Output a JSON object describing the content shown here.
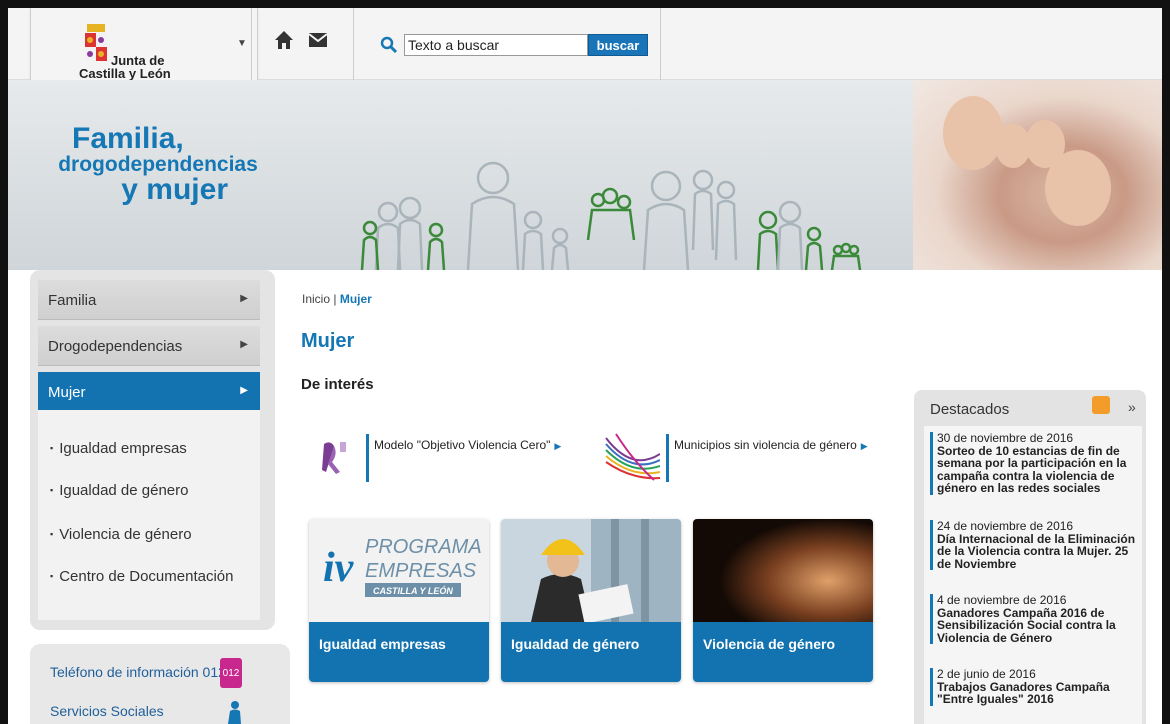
{
  "header": {
    "logo_line1": "Junta de",
    "logo_line2": "Castilla y León",
    "search_placeholder": "Texto a buscar",
    "search_value": "Texto a buscar",
    "search_button": "buscar"
  },
  "banner": {
    "title_line1": "Familia,",
    "title_line2": "drogodependencias",
    "title_line3": "y mujer"
  },
  "nav": {
    "items": [
      {
        "label": "Familia",
        "active": false
      },
      {
        "label": "Drogodependencias",
        "active": false
      },
      {
        "label": "Mujer",
        "active": true
      }
    ],
    "subitems": [
      {
        "label": "Igualdad empresas"
      },
      {
        "label": "Igualdad de género"
      },
      {
        "label": "Violencia de género"
      },
      {
        "label": "Centro de Documentación"
      }
    ],
    "links": [
      {
        "label": "Teléfono de información 012"
      },
      {
        "label": "Servicios Sociales"
      }
    ],
    "phone_icon_text": "012"
  },
  "breadcrumb": {
    "home": "Inicio",
    "current": "Mujer"
  },
  "page_title": "Mujer",
  "section_title": "De interés",
  "interest_links": [
    {
      "label": "Modelo \"Objetivo Violencia Cero\""
    },
    {
      "label": "Municipios sin violencia de género"
    }
  ],
  "cards": [
    {
      "label": "Igualdad empresas",
      "image_text1": "PROGRAMA",
      "image_text2": "EMPRESAS",
      "image_text3": "CASTILLA Y LEÓN"
    },
    {
      "label": "Igualdad de género"
    },
    {
      "label": "Violencia de género"
    }
  ],
  "destacados": {
    "title": "Destacados",
    "more": "»",
    "items": [
      {
        "date": "30 de noviembre de 2016",
        "headline": "Sorteo de 10 estancias de fin de semana por la participación en la campaña contra la violencia de género en las redes sociales"
      },
      {
        "date": "24 de noviembre de 2016",
        "headline": "Día Internacional de la Eliminación de la Violencia contra la Mujer. 25 de Noviembre"
      },
      {
        "date": "4 de noviembre de 2016",
        "headline": "Ganadores Campaña 2016 de Sensibilización Social contra la Violencia de Género"
      },
      {
        "date": "2 de junio de 2016",
        "headline": "Trabajos Ganadores Campaña \"Entre Iguales\" 2016"
      }
    ]
  },
  "colors": {
    "brand_blue": "#1273b0",
    "title_blue": "#1577b4",
    "rss_orange": "#f39c2a",
    "phone_pink": "#c8288d"
  }
}
